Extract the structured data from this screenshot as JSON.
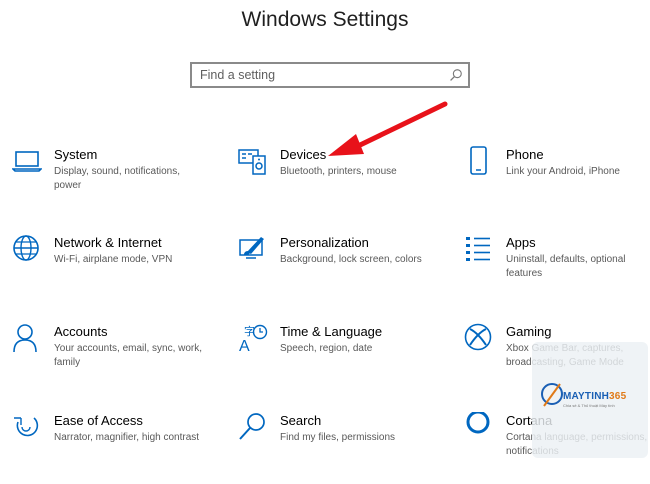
{
  "window": {
    "title": "Windows Settings"
  },
  "search": {
    "placeholder": "Find a setting",
    "icon": "search-icon"
  },
  "accent_color": "#0067c0",
  "tiles": [
    {
      "title": "System",
      "description": "Display, sound, notifications, power",
      "icon": "laptop-icon"
    },
    {
      "title": "Devices",
      "description": "Bluetooth, printers, mouse",
      "icon": "devices-icon"
    },
    {
      "title": "Phone",
      "description": "Link your Android, iPhone",
      "icon": "phone-icon"
    },
    {
      "title": "Network & Internet",
      "description": "Wi-Fi, airplane mode, VPN",
      "icon": "globe-icon"
    },
    {
      "title": "Personalization",
      "description": "Background, lock screen, colors",
      "icon": "paintbrush-icon"
    },
    {
      "title": "Apps",
      "description": "Uninstall, defaults, optional features",
      "icon": "apps-list-icon"
    },
    {
      "title": "Accounts",
      "description": "Your accounts, email, sync, work, family",
      "icon": "person-icon"
    },
    {
      "title": "Time & Language",
      "description": "Speech, region, date",
      "icon": "time-language-icon"
    },
    {
      "title": "Gaming",
      "description": "Xbox Game Bar, captures, broadcasting, Game Mode",
      "icon": "xbox-icon"
    },
    {
      "title": "Ease of Access",
      "description": "Narrator, magnifier, high contrast",
      "icon": "ease-of-access-icon"
    },
    {
      "title": "Search",
      "description": "Find my files, permissions",
      "icon": "search-icon"
    },
    {
      "title": "Cortana",
      "description": "Cortana language, permissions, notifications",
      "icon": "cortana-icon"
    }
  ],
  "annotation": {
    "color": "#e8121a",
    "icon": "red-arrow"
  },
  "watermark": {
    "brand_prefix": "MAYTINH",
    "brand_number": "365",
    "tagline": "Chia sẻ & Thủ thuật Máy tính"
  }
}
